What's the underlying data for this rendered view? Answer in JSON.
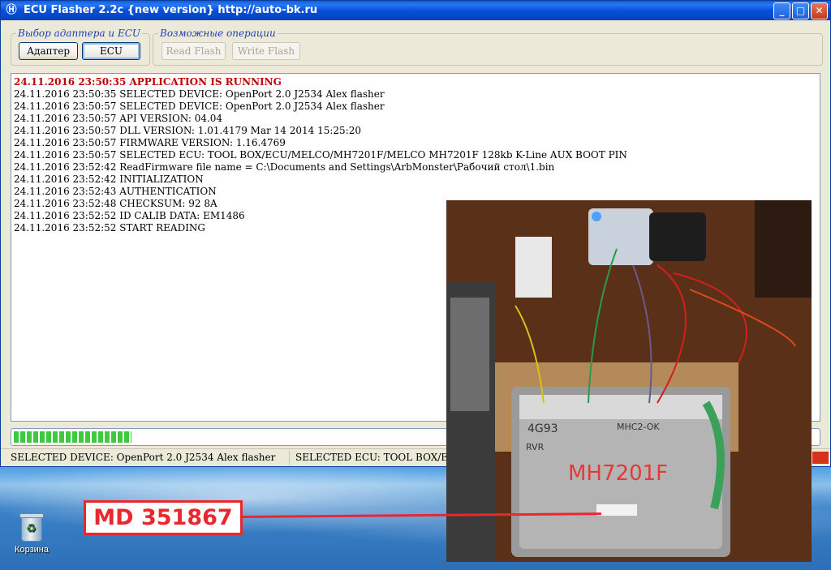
{
  "window": {
    "title": "ECU Flasher 2.2c {new version} http://auto-bk.ru",
    "controls": {
      "minimize": "_",
      "maximize": "□",
      "close": "✕"
    }
  },
  "groups": {
    "adapter_group": {
      "legend": "Выбор адаптера и ECU",
      "adapter_button": "Адаптер",
      "ecu_button": "ECU"
    },
    "operations_group": {
      "legend": "Возможные операции",
      "read_flash_button": "Read Flash",
      "write_flash_button": "Write Flash"
    }
  },
  "log": [
    "24.11.2016 23:50:35 APPLICATION IS RUNNING",
    "24.11.2016 23:50:35 SELECTED DEVICE: OpenPort 2.0 J2534 Alex flasher",
    "24.11.2016 23:50:57 SELECTED DEVICE: OpenPort 2.0 J2534 Alex flasher",
    "24.11.2016 23:50:57 API VERSION: 04.04",
    "24.11.2016 23:50:57 DLL VERSION: 1.01.4179 Mar 14 2014 15:25:20",
    "24.11.2016 23:50:57 FIRMWARE VERSION: 1.16.4769",
    "24.11.2016 23:50:57 SELECTED ECU: TOOL BOX/ECU/MELCO/MH7201F/MELCO MH7201F 128kb K-Line AUX BOOT PIN",
    "24.11.2016 23:52:42 ReadFirmware file name = C:\\Documents and Settings\\ArbMonster\\Рабочий стол\\1.bin",
    "24.11.2016 23:52:42 INITIALIZATION",
    "24.11.2016 23:52:43 AUTHENTICATION",
    "24.11.2016 23:52:48 CHECKSUM: 92 8A",
    "24.11.2016 23:52:52 ID CALIB DATA: EM1486",
    "24.11.2016 23:52:52 START READING"
  ],
  "progress": {
    "fraction": 0.146
  },
  "status": {
    "device": "SELECTED DEVICE: OpenPort 2.0 J2534 Alex flasher",
    "ecu": "SELECTED ECU: TOOL BOX/ECU/"
  },
  "photo": {
    "ecu_marking": "MH7201F",
    "code_left": "4G93",
    "code_right": "MHC2-OK",
    "code_sub": "RVR"
  },
  "callout": {
    "text": "MD 351867"
  },
  "desktop": {
    "recycle_bin_label": "Корзина"
  },
  "colors": {
    "alert_text": "#c00000",
    "callout_red": "#e8282e",
    "title_blue": "#0650d8"
  }
}
